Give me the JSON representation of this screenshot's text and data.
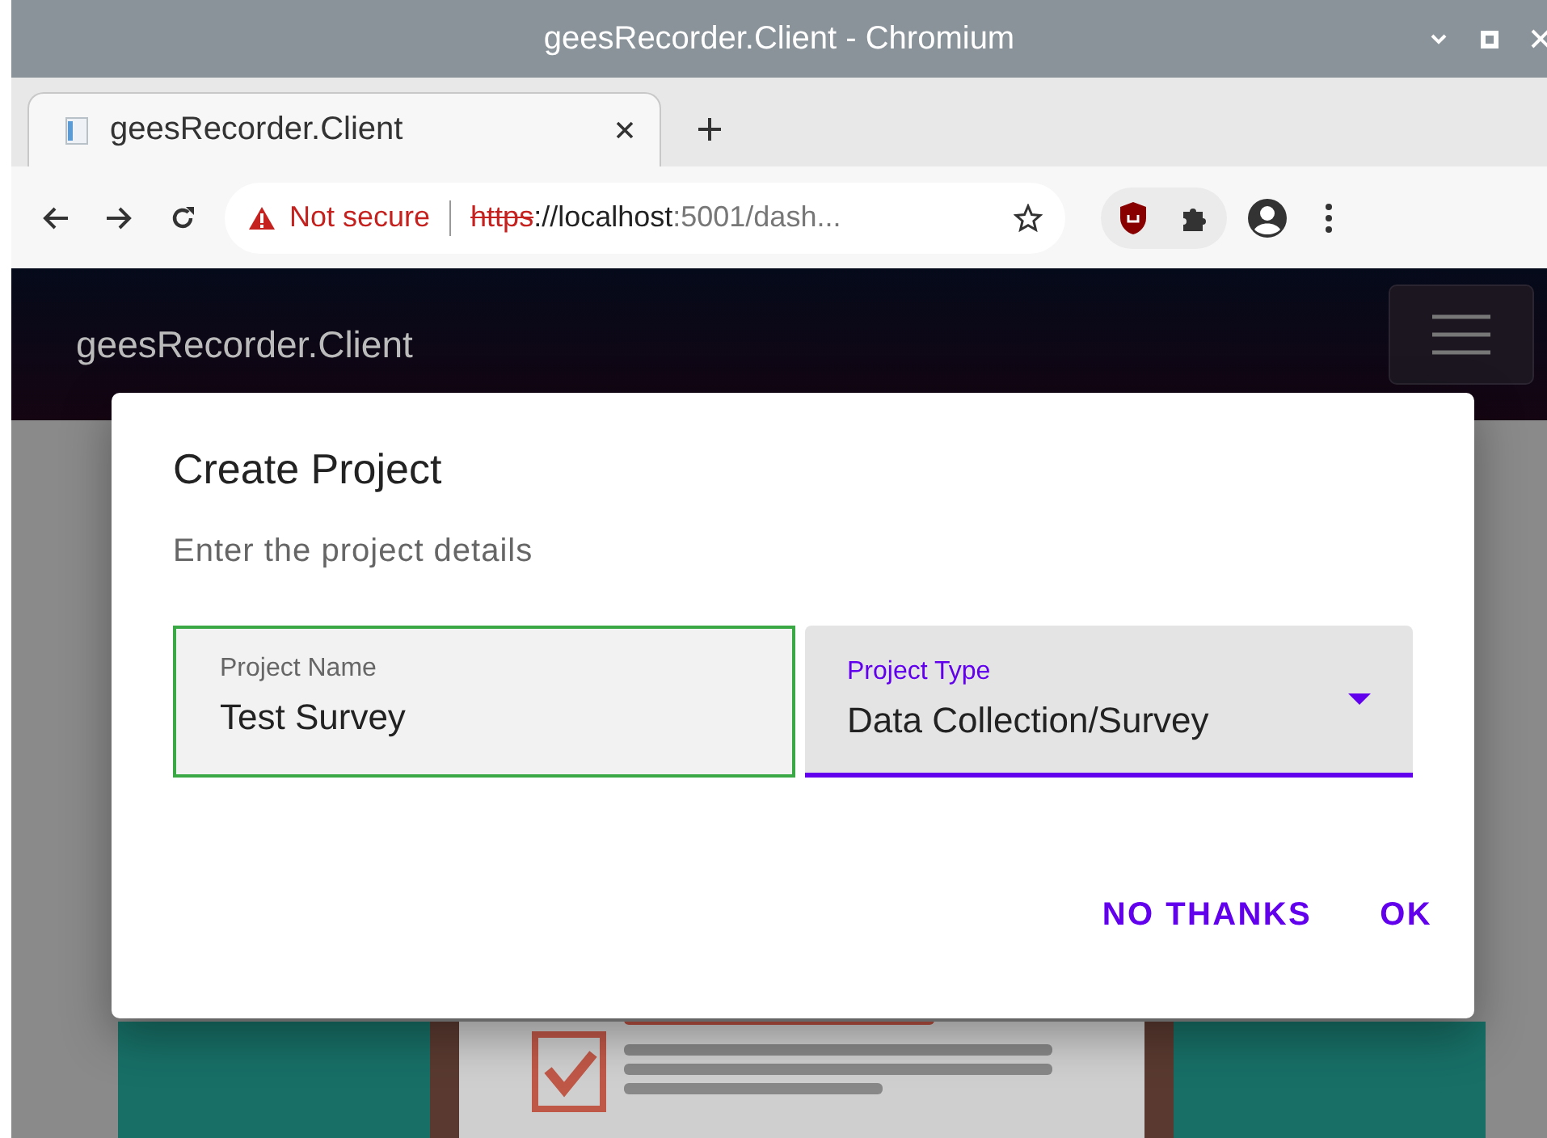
{
  "window": {
    "title": "geesRecorder.Client - Chromium"
  },
  "tabs": [
    {
      "label": "geesRecorder.Client",
      "selected": true
    }
  ],
  "address_bar": {
    "security": "Not secure",
    "scheme": "https",
    "rest_host": "://localhost",
    "rest_path": ":5001/dash..."
  },
  "navbar": {
    "brand": "geesRecorder.Client"
  },
  "dialog": {
    "title": "Create Project",
    "subtitle": "Enter the project details",
    "fields": [
      {
        "kind": "text",
        "label": "Project Name",
        "value": "Test Survey",
        "valid": true,
        "focused": false
      },
      {
        "kind": "select",
        "label": "Project Type",
        "value": "Data Collection/Survey",
        "valid": false,
        "focused": true
      }
    ],
    "buttons": [
      "NO THANKS",
      "OK"
    ]
  }
}
